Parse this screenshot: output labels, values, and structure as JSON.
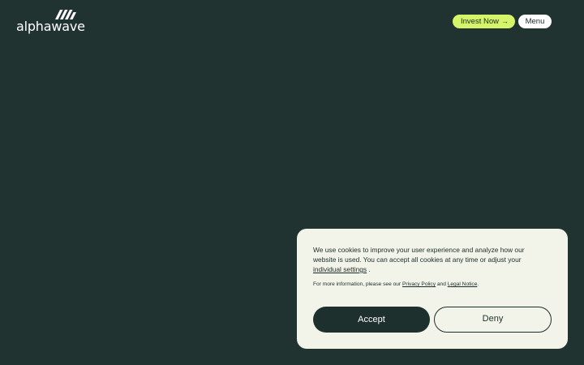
{
  "header": {
    "logo_text": "alphawave",
    "invest_label": "Invest Now",
    "invest_arrow": "→",
    "menu_label": "Menu"
  },
  "cookie_banner": {
    "text_before": "We use cookies to improve your user experience and analyze how our website is used. You can accept all cookies at any time or adjust your",
    "settings_link": "individual settings",
    "text_after": " .",
    "info_before": "For more information, please see our",
    "privacy_link": "Privacy Policy",
    "info_and": "and",
    "legal_link": "Legal Notice",
    "info_end": ".",
    "accept_label": "Accept",
    "deny_label": "Deny"
  },
  "colors": {
    "background": "#213331",
    "accent": "#d6f46a",
    "banner": "#f3f4e9",
    "dark": "#1e302e"
  },
  "icons": {
    "logo_mark": "alphawave-logo-mark",
    "invest_arrow": "arrow-right-icon"
  }
}
